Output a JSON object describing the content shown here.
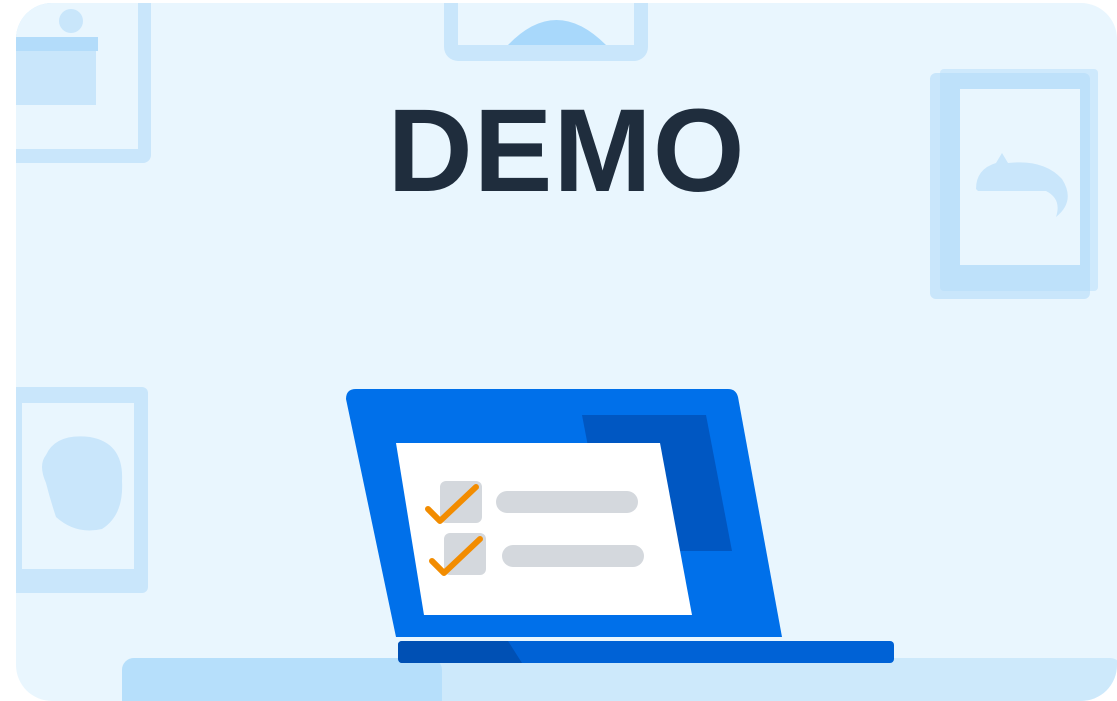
{
  "title": "DEMO",
  "illustration": {
    "subject": "laptop-with-checklist",
    "checklist_items": 2,
    "colors": {
      "background": "#e9f6fe",
      "laptop_blue": "#0070ea",
      "laptop_dark_blue": "#0057c2",
      "check_orange": "#f28c00",
      "frame_light": "#c9e6fb",
      "frame_mid": "#b3dcfa",
      "title_color": "#1f2d3d"
    }
  }
}
